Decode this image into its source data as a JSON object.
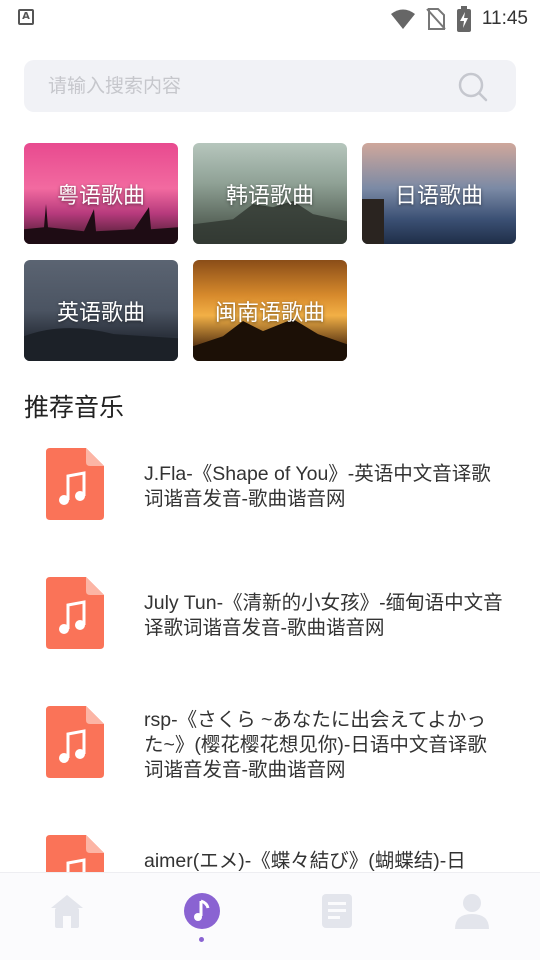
{
  "status_bar": {
    "app_badge": "A",
    "time": "11:45"
  },
  "search": {
    "placeholder": "请输入搜索内容",
    "value": ""
  },
  "categories": [
    {
      "label": "粤语歌曲"
    },
    {
      "label": "韩语歌曲"
    },
    {
      "label": "日语歌曲"
    },
    {
      "label": "英语歌曲"
    },
    {
      "label": "闽南语歌曲"
    }
  ],
  "section_title": "推荐音乐",
  "songs": [
    {
      "title": "J.Fla-《Shape of You》-英语中文音译歌词谐音发音-歌曲谐音网"
    },
    {
      "title": "July Tun-《清新的小女孩》-缅甸语中文音译歌词谐音发音-歌曲谐音网"
    },
    {
      "title": "rsp-《さくら ~あなたに出会えてよかった~》(樱花樱花想见你)-日语中文音译歌词谐音发音-歌曲谐音网"
    },
    {
      "title": "aimer(エメ)-《蝶々結び》(蝴蝶结)-日"
    }
  ],
  "bottom_nav": {
    "items": [
      {
        "icon": "home-icon",
        "active": false
      },
      {
        "icon": "music-note-icon",
        "active": true
      },
      {
        "icon": "document-icon",
        "active": false
      },
      {
        "icon": "user-icon",
        "active": false
      }
    ]
  },
  "colors": {
    "accent": "#8a63d2",
    "song_icon": "#fa7358",
    "nav_inactive": "#e3e5ec",
    "search_bg": "#f1f2f6"
  }
}
